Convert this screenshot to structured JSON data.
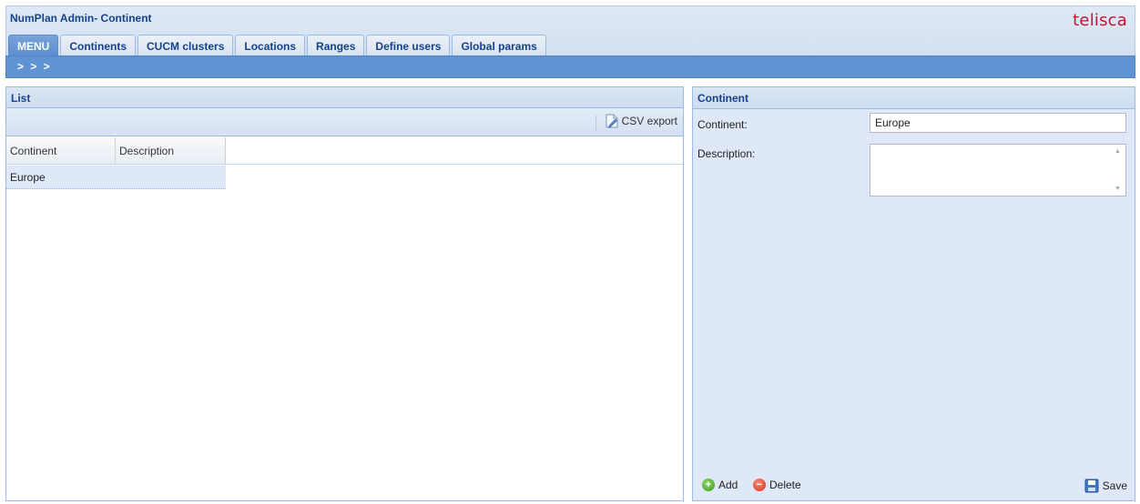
{
  "app": {
    "title": "NumPlan Admin- Continent",
    "brand": "telisca"
  },
  "tabs": [
    "MENU",
    "Continents",
    "CUCM clusters",
    "Locations",
    "Ranges",
    "Define users",
    "Global params"
  ],
  "subbar": {
    "chevrons": "> > >"
  },
  "list": {
    "title": "List",
    "csv_label": "CSV export",
    "columns": [
      "Continent",
      "Description"
    ],
    "rows": [
      {
        "continent": "Europe",
        "description": ""
      }
    ]
  },
  "form": {
    "title": "Continent",
    "continent_label": "Continent:",
    "continent_value": "Europe",
    "description_label": "Description:",
    "description_value": "",
    "add_label": "Add",
    "delete_label": "Delete",
    "save_label": "Save"
  },
  "colors": {
    "accent": "#5f93d1",
    "brand": "#c8102e",
    "panel_bg": "#dfe8f6"
  }
}
